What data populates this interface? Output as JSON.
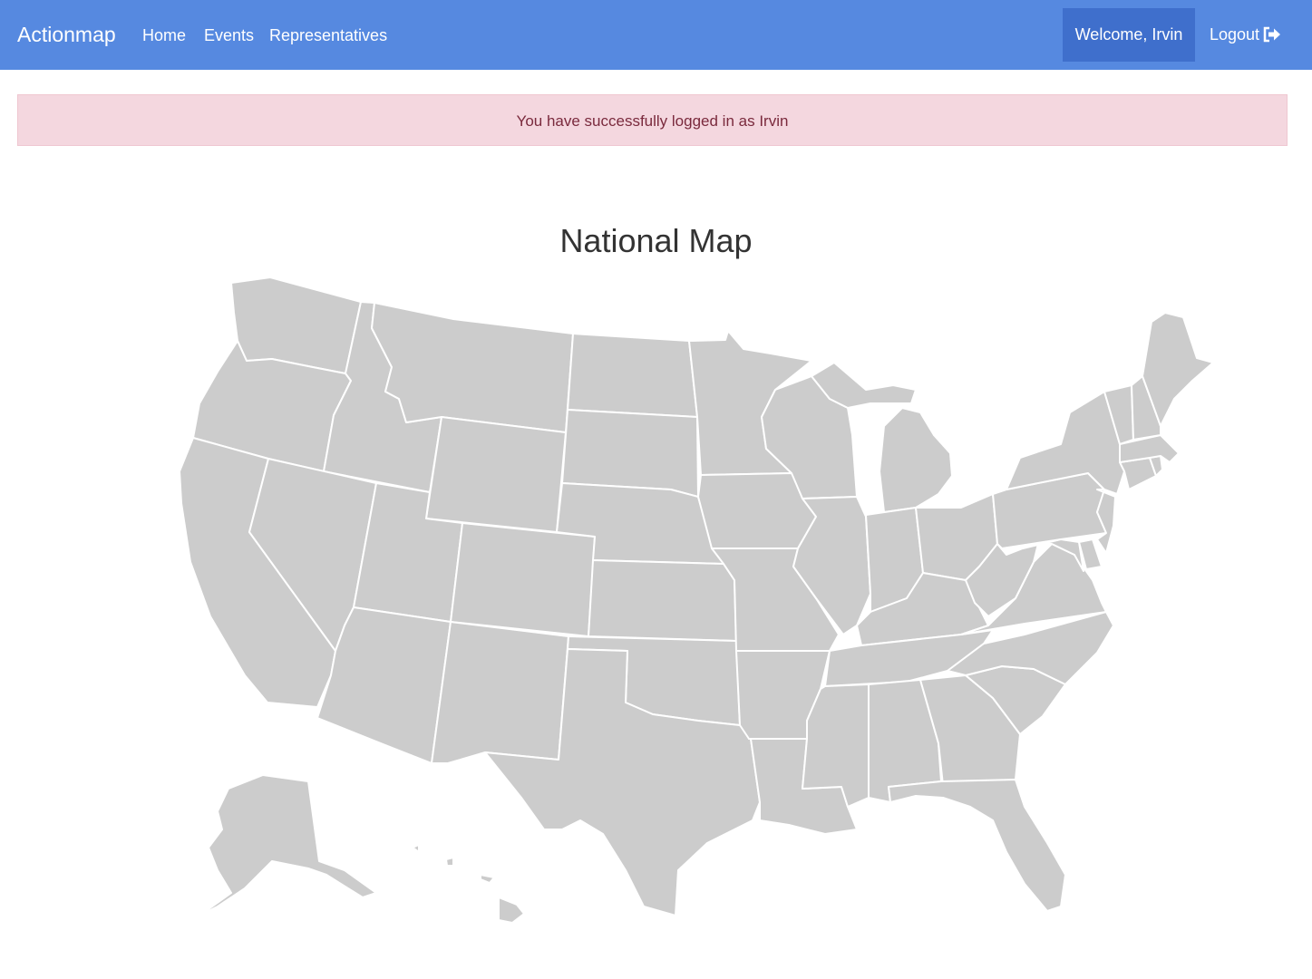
{
  "navbar": {
    "brand": "Actionmap",
    "links": [
      {
        "label": "Home"
      },
      {
        "label": "Events"
      },
      {
        "label": "Representatives"
      }
    ],
    "welcome_label": "Welcome,  Irvin",
    "logout_label": "Logout",
    "background": "#5689e0",
    "welcome_background": "#3f6fcc"
  },
  "alert": {
    "message": "You have successfully logged in as Irvin",
    "background": "#f4d7df"
  },
  "main": {
    "title": "National Map"
  },
  "map": {
    "fill": "#cccccc",
    "stroke": "#ffffff",
    "regions": [
      "WA",
      "OR",
      "CA",
      "ID",
      "NV",
      "MT",
      "WY",
      "UT",
      "AZ",
      "CO",
      "NM",
      "ND",
      "SD",
      "NE",
      "KS",
      "OK",
      "TX",
      "MN",
      "IA",
      "MO",
      "AR",
      "LA",
      "WI",
      "IL",
      "MI",
      "IN",
      "OH",
      "KY",
      "TN",
      "MS",
      "AL",
      "GA",
      "FL",
      "SC",
      "NC",
      "VA",
      "WV",
      "PA",
      "NY",
      "MD",
      "DE",
      "NJ",
      "CT",
      "RI",
      "MA",
      "VT",
      "NH",
      "ME",
      "AK",
      "HI"
    ]
  }
}
